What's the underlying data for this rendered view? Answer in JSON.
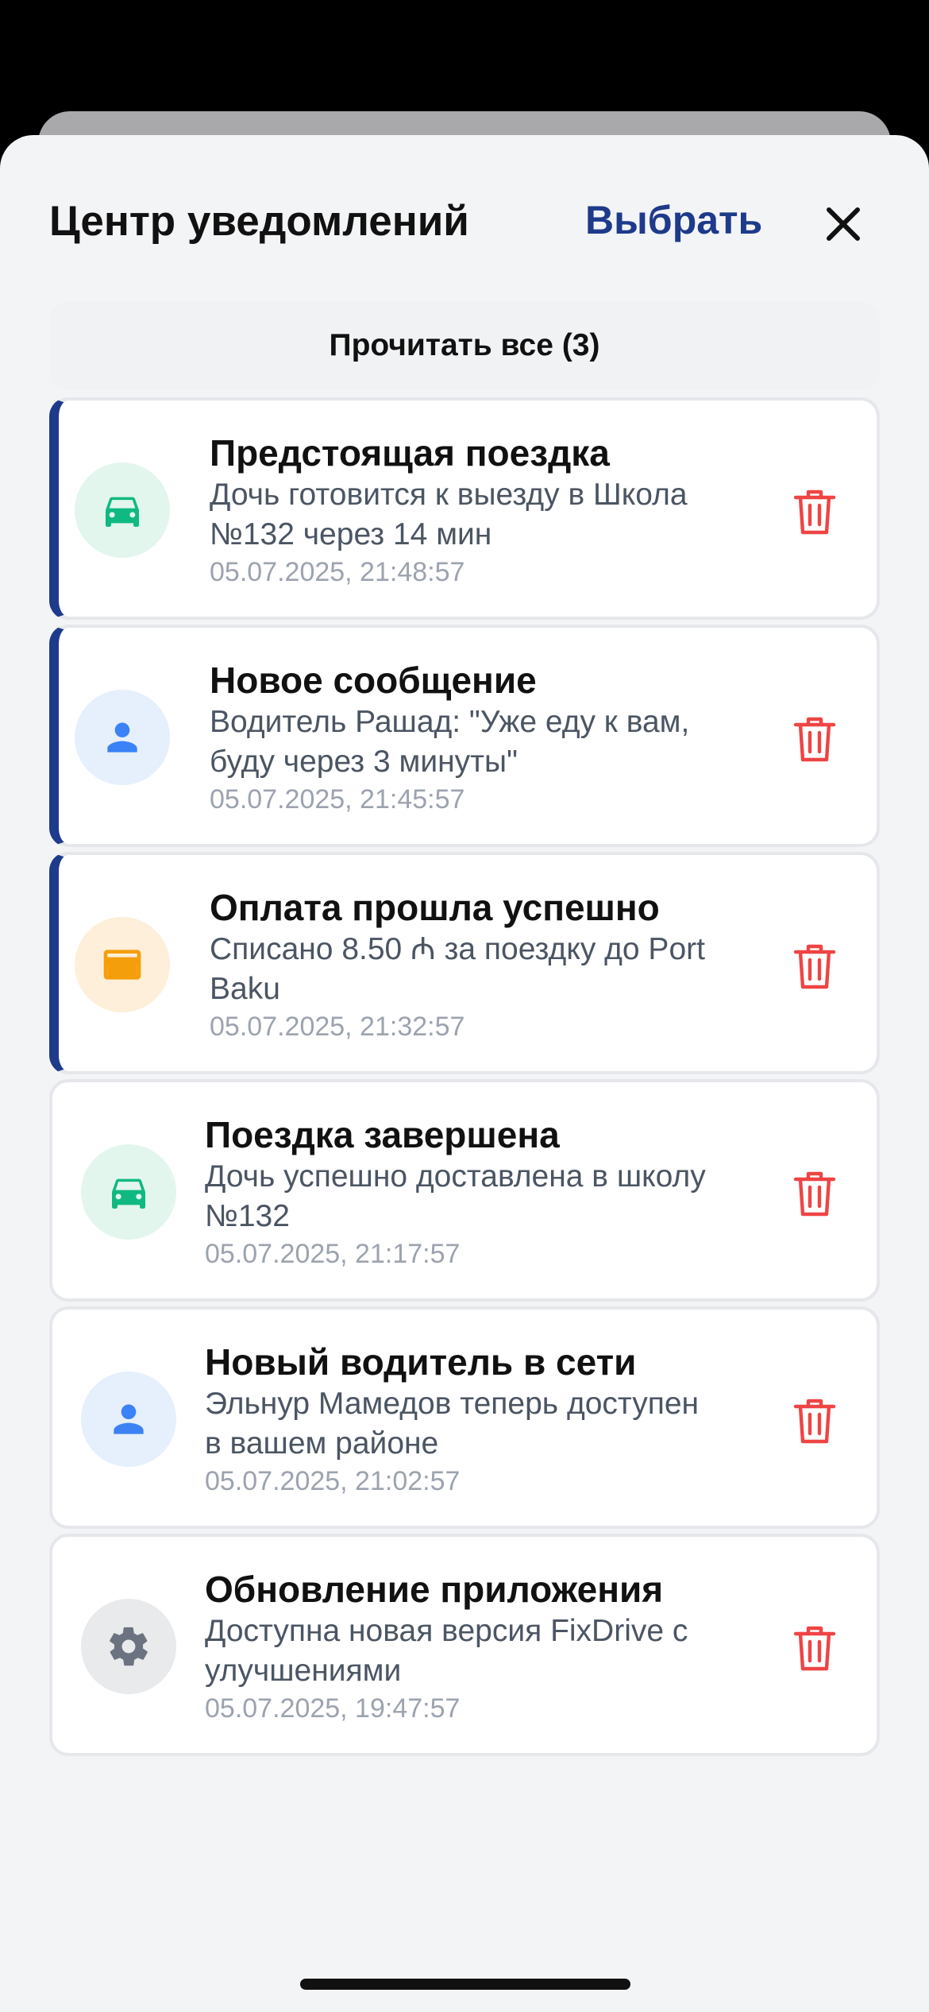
{
  "header": {
    "title": "Центр уведомлений",
    "select_label": "Выбрать"
  },
  "read_all": {
    "label": "Прочитать все (3)"
  },
  "colors": {
    "accent": "#1e3a8a",
    "trash": "#ef4444",
    "green_bg": "#e3f6ee",
    "green_fg": "#10b981",
    "blue_bg": "#e6effc",
    "blue_fg": "#3b82f6",
    "orange_bg": "#fdefd9",
    "orange_fg": "#f59e0b",
    "gray_bg": "#e9eaec",
    "gray_fg": "#6b7280"
  },
  "notifications": [
    {
      "title": "Предстоящая поездка",
      "message_line1": "Дочь готовится к выезду в Школа",
      "message_line2": "№132 через 14 мин",
      "time": "05.07.2025, 21:48:57",
      "icon": "car-icon",
      "unread": true
    },
    {
      "title": "Новое сообщение",
      "message_line1": "Водитель Рашад: \"Уже еду к вам,",
      "message_line2": "буду через 3 минуты\"",
      "time": "05.07.2025, 21:45:57",
      "icon": "user-icon",
      "unread": true
    },
    {
      "title": "Оплата прошла успешно",
      "message_line1": "Списано 8.50 ₼ за поездку до Port",
      "message_line2": "Baku",
      "time": "05.07.2025, 21:32:57",
      "icon": "card-icon",
      "unread": true
    },
    {
      "title": "Поездка завершена",
      "message_line1": "Дочь успешно доставлена в школу",
      "message_line2": "№132",
      "time": "05.07.2025, 21:17:57",
      "icon": "car-icon",
      "unread": false
    },
    {
      "title": "Новый водитель в сети",
      "message_line1": "Эльнур Мамедов теперь доступен",
      "message_line2": "в вашем районе",
      "time": "05.07.2025, 21:02:57",
      "icon": "user-icon",
      "unread": false
    },
    {
      "title": "Обновление приложения",
      "message_line1": "Доступна новая версия FixDrive с",
      "message_line2": "улучшениями",
      "time": "05.07.2025, 19:47:57",
      "icon": "gear-icon",
      "unread": false
    }
  ]
}
